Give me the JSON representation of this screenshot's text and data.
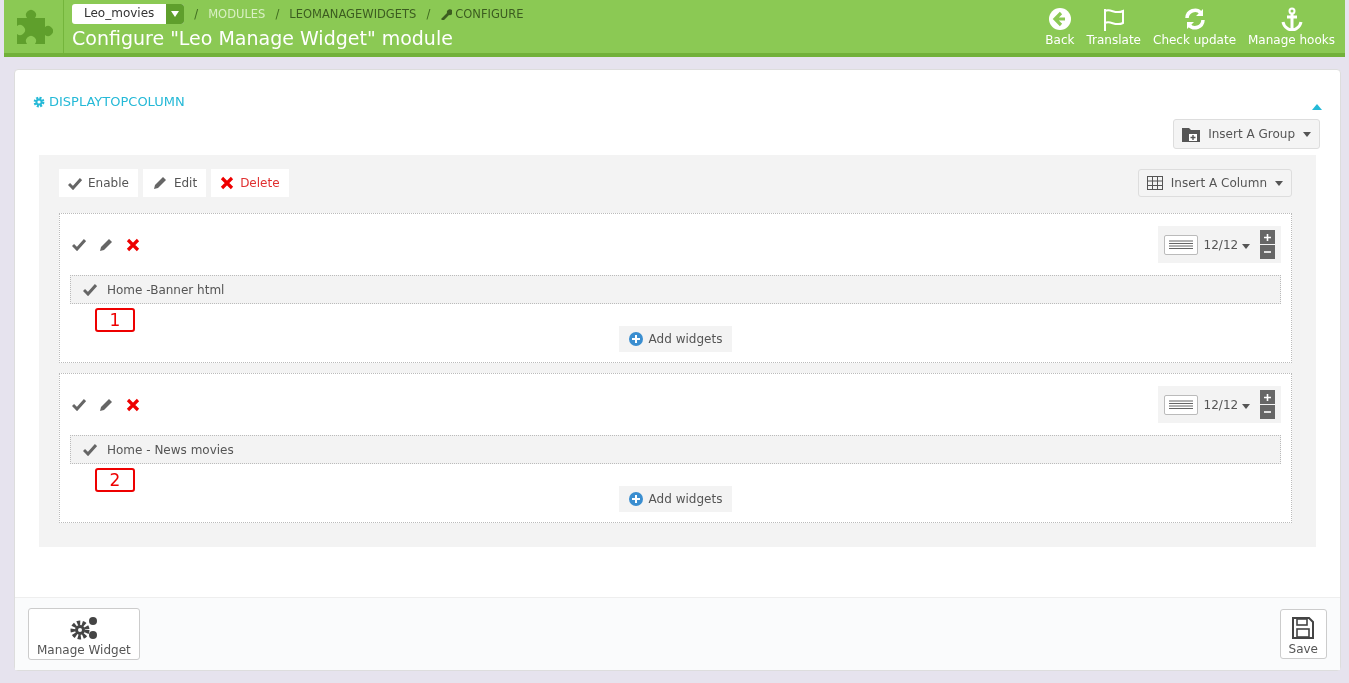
{
  "header": {
    "shop_selector": "Leo_movies",
    "breadcrumbs": [
      {
        "separator": "/",
        "label": "MODULES",
        "kind": "link"
      },
      {
        "separator": "/",
        "label": "LEOMANAGEWIDGETS",
        "kind": "current"
      },
      {
        "separator": "/",
        "label": "CONFIGURE",
        "kind": "configure"
      }
    ],
    "title": "Configure \"Leo Manage Widget\" module",
    "toolbar": [
      {
        "label": "Back",
        "kind": "back"
      },
      {
        "label": "Translate",
        "kind": "translate"
      },
      {
        "label": "Check update",
        "kind": "update"
      },
      {
        "label": "Manage hooks",
        "kind": "hooks"
      }
    ]
  },
  "panel": {
    "heading": "DISPLAYTOPCOLUMN",
    "expanded": true,
    "insert_group": "Insert A Group"
  },
  "group": {
    "actions": [
      {
        "label": "Enable",
        "kind": "enable"
      },
      {
        "label": "Edit",
        "kind": "edit"
      },
      {
        "label": "Delete",
        "kind": "delete"
      }
    ],
    "insert_column": "Insert A Column",
    "columns": [
      {
        "width": "12/12",
        "widgets": [
          {
            "name": "Home -Banner html",
            "callout": "1"
          }
        ],
        "add_widgets": "Add widgets"
      },
      {
        "width": "12/12",
        "widgets": [
          {
            "name": "Home - News movies",
            "callout": "2"
          }
        ],
        "add_widgets": "Add widgets"
      }
    ]
  },
  "footer": {
    "buttons": [
      {
        "label": "Manage Widget",
        "kind": "manage"
      },
      {
        "label": "Save",
        "kind": "save"
      }
    ]
  }
}
